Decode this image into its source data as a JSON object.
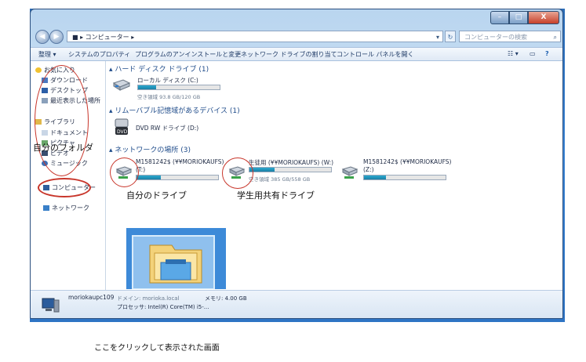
{
  "window": {
    "address_path": "■ ▸ コンピューター ▸",
    "search_placeholder": "コンピューターの検索",
    "min_glyph": "–",
    "max_glyph": "□",
    "close_glyph": "X"
  },
  "toolbar": {
    "organize": "整理 ▾",
    "system_properties": "システムのプロパティ",
    "uninstall": "プログラムのアンインストールと変更",
    "map_drive": "ネットワーク ドライブの割り当て",
    "control_panel": "コントロール パネルを開く",
    "view_glyph": "☷ ▾",
    "preview_glyph": "▭",
    "help_glyph": "?"
  },
  "nav": {
    "favorites": "お気に入り",
    "downloads": "ダウンロード",
    "desktop": "デスクトップ",
    "recent": "最近表示した場所",
    "libraries": "ライブラリ",
    "documents": "ドキュメント",
    "pictures": "ピクチャ",
    "videos": "ビデオ",
    "music": "ミュージック",
    "computer": "コンピューター",
    "network": "ネットワーク"
  },
  "content": {
    "hdd_group": "ハード ディスク ドライブ (1)",
    "local_disk": {
      "name": "ローカル ディスク (C:)",
      "free": "空き領域 93.8 GB/120 GB",
      "used_fraction": 0.22
    },
    "removable_group": "リムーバブル記憶域があるデバイス (1)",
    "dvd": {
      "name": "DVD RW ドライブ (D:)",
      "label": "DVD"
    },
    "network_group": "ネットワークの場所 (3)",
    "net_drives": [
      {
        "name": "M1581242$ (¥¥MORIOKAUFS)",
        "letter": "(T:)",
        "free": "",
        "used_fraction": 0.3
      },
      {
        "name": "生徒用 (¥¥MORIOKAUFS) (W:)",
        "letter": "",
        "free": "空き領域 385 GB/558 GB",
        "used_fraction": 0.31
      },
      {
        "name": "M1581242$ (¥¥MORIOKAUFS)",
        "letter": "(Z:)",
        "free": "",
        "used_fraction": 0.27
      }
    ]
  },
  "details": {
    "pc_name": "moriokaupc109",
    "domain_label": "ドメイン: morioka.local",
    "memory": "メモリ: 4.00 GB",
    "processor": "プロセッサ: Intel(R) Core(TM) i5-..."
  },
  "annotations": {
    "my_folder": "自分のフォルダ",
    "my_drive": "自分のドライブ",
    "shared_drive": "学生用共有ドライブ"
  },
  "caption": "ここをクリックして表示された画面",
  "colors": {
    "annotation_red": "#c8352a",
    "titlebar_blue": "#2e74c4",
    "bar_fill": "#1b7fa6"
  }
}
